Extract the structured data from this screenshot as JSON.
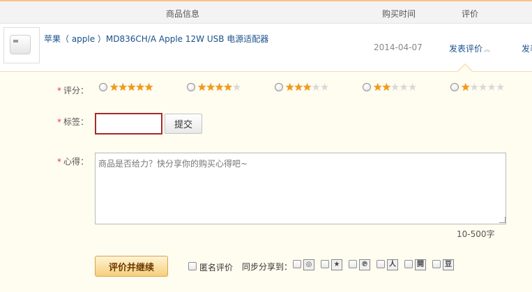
{
  "header": {
    "product_info": "商品信息",
    "purchase_time": "购买时间",
    "rating": "评价"
  },
  "product": {
    "title": "苹果（ apple ）MD836CH/A Apple 12W USB 电源适配器",
    "purchase_date": "2014-04-07",
    "rate_link": "发表评价",
    "rate_link_next": "发表"
  },
  "form": {
    "score_label": "评分：",
    "tag_label": "标签：",
    "experience_label": "心得：",
    "required_mark": "*",
    "score_options": [
      {
        "stars": 5,
        "filled": 5
      },
      {
        "stars": 5,
        "filled": 4
      },
      {
        "stars": 5,
        "filled": 3
      },
      {
        "stars": 5,
        "filled": 2
      },
      {
        "stars": 5,
        "filled": 1
      }
    ],
    "tag_input_value": "",
    "submit_label": "提交",
    "experience_placeholder": "商品是否给力？快分享你的购买心得吧~",
    "char_limit": "10-500字",
    "main_submit": "评价并继续",
    "anonymous_label": "匿名评价",
    "share_label": "同步分享到："
  },
  "share_icons": [
    {
      "name": "sina-weibo-icon",
      "glyph": "◎"
    },
    {
      "name": "qzone-icon",
      "glyph": "★"
    },
    {
      "name": "pengyou-icon",
      "glyph": "℗"
    },
    {
      "name": "renren-icon",
      "glyph": "人"
    },
    {
      "name": "kaixin-icon",
      "glyph": "開"
    },
    {
      "name": "douban-icon",
      "glyph": "豆"
    }
  ],
  "colors": {
    "accent_link": "#1a4f8a",
    "required": "#e4393c",
    "star_on": "#f39a15",
    "panel_bg": "#fffdf0"
  }
}
